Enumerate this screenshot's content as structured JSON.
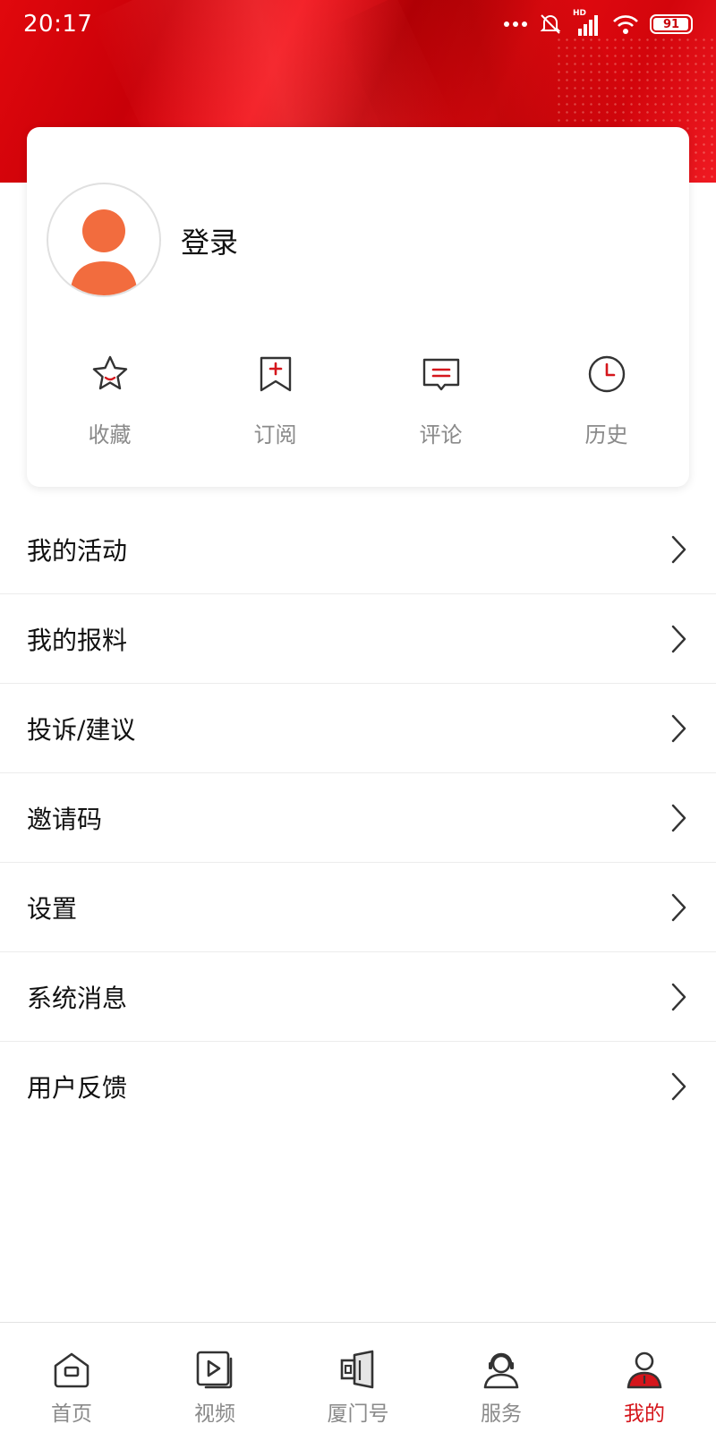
{
  "status_bar": {
    "time": "20:17",
    "battery": "91",
    "network_label": "HD"
  },
  "profile": {
    "login_label": "登录",
    "avatar_color": "#f26c3e"
  },
  "quick_actions": [
    {
      "label": "收藏",
      "icon": "star-icon"
    },
    {
      "label": "订阅",
      "icon": "bookmark-plus-icon"
    },
    {
      "label": "评论",
      "icon": "comment-icon"
    },
    {
      "label": "历史",
      "icon": "clock-icon"
    }
  ],
  "menu": [
    {
      "label": "我的活动"
    },
    {
      "label": "我的报料"
    },
    {
      "label": "投诉/建议"
    },
    {
      "label": "邀请码"
    },
    {
      "label": "设置"
    },
    {
      "label": "系统消息"
    },
    {
      "label": "用户反馈"
    }
  ],
  "tabs": [
    {
      "label": "首页",
      "icon": "home-icon"
    },
    {
      "label": "视频",
      "icon": "video-icon"
    },
    {
      "label": "厦门号",
      "icon": "door-icon"
    },
    {
      "label": "服务",
      "icon": "service-icon"
    },
    {
      "label": "我的",
      "icon": "user-icon",
      "active": true
    }
  ],
  "colors": {
    "brand_red": "#d5161c",
    "icon_gray": "#333333",
    "label_gray": "#8a8a8a"
  }
}
